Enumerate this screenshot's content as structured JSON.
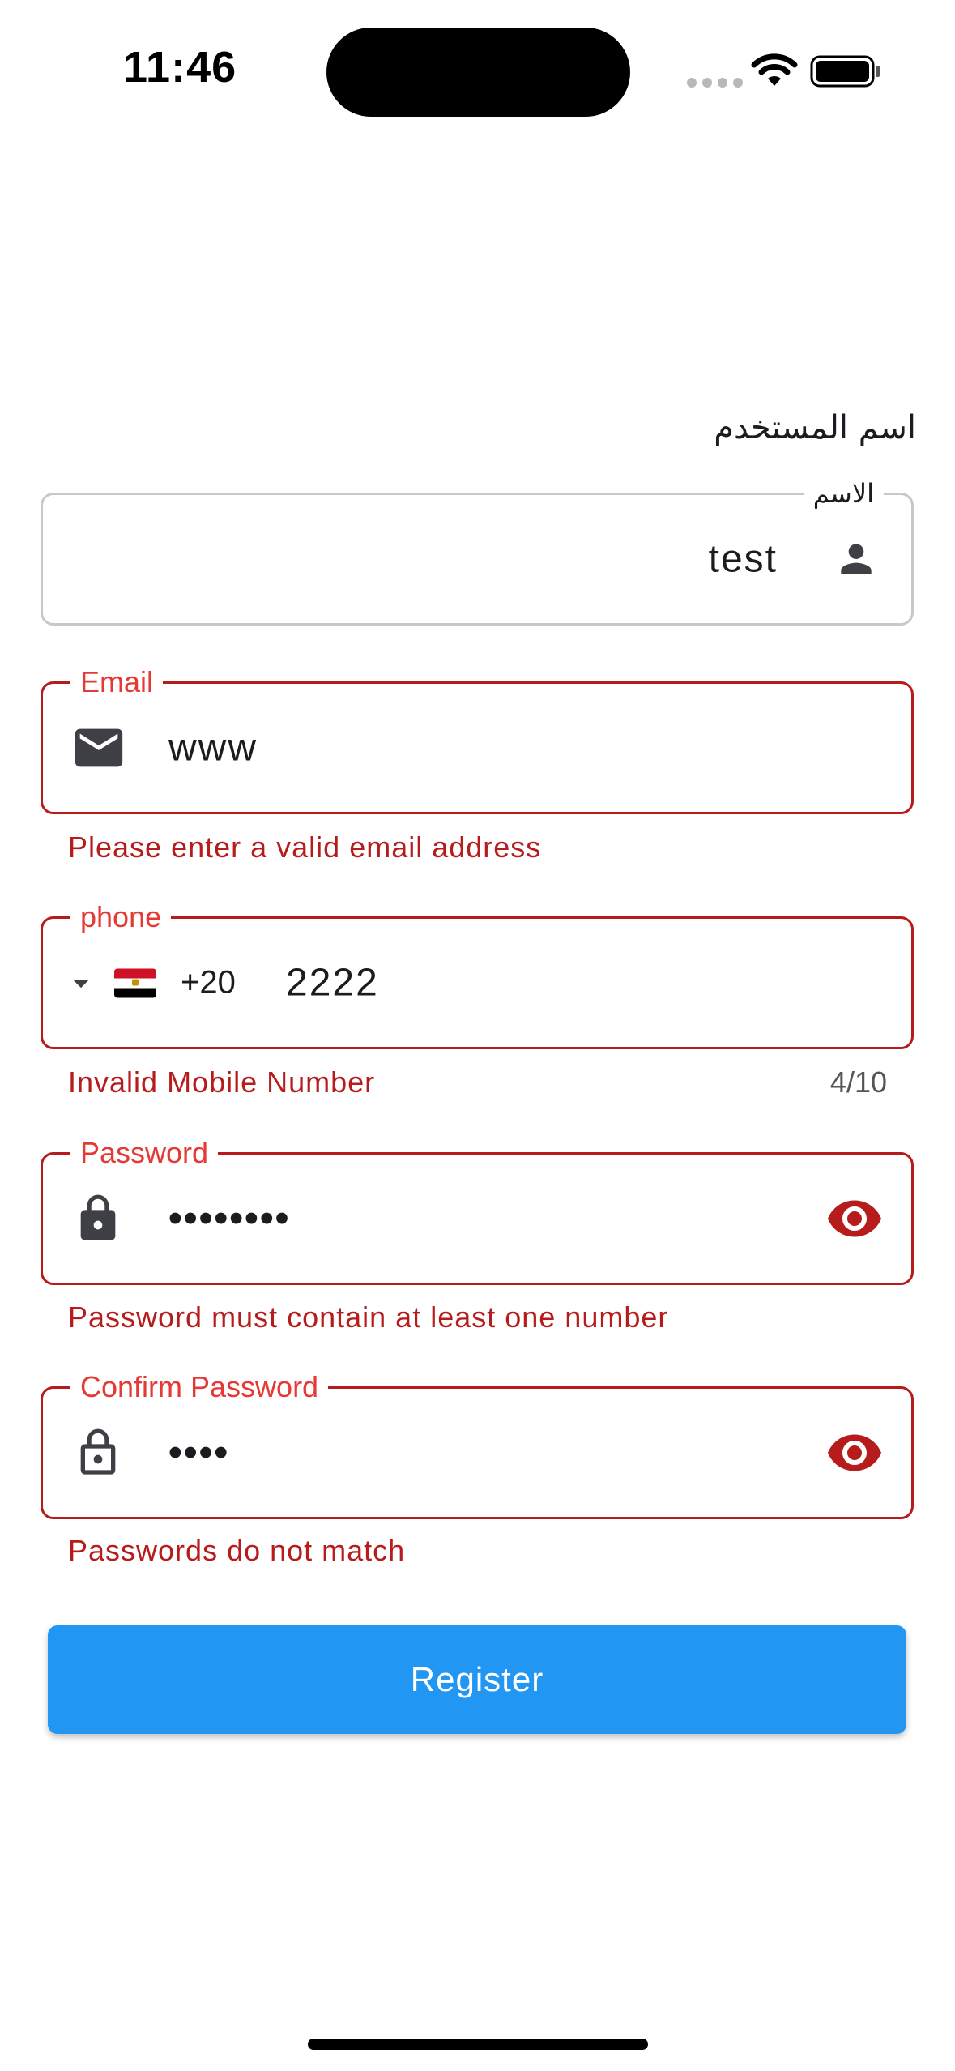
{
  "status_bar": {
    "time": "11:46"
  },
  "form": {
    "section_title": "اسم المستخدم",
    "name": {
      "label": "الاسم",
      "value": "test",
      "icon": "person-icon"
    },
    "email": {
      "label": "Email",
      "value": "www",
      "error": "Please enter a valid email address",
      "icon": "mail-icon"
    },
    "phone": {
      "label": "phone",
      "country_code": "+20",
      "flag": "egypt-flag",
      "value": "2222",
      "error": "Invalid Mobile Number",
      "counter": "4/10"
    },
    "password": {
      "label": "Password",
      "value": "••••••••",
      "error": "Password must contain at least one number",
      "icon": "lock-icon"
    },
    "confirm_password": {
      "label": "Confirm Password",
      "value": "••••",
      "error": "Passwords do not match",
      "icon": "lock-open-icon"
    }
  },
  "register_button": {
    "label": "Register"
  },
  "colors": {
    "error": "#b71c1c",
    "error_label": "#e53935",
    "primary": "#2196f3",
    "border": "#c8c8c8"
  }
}
